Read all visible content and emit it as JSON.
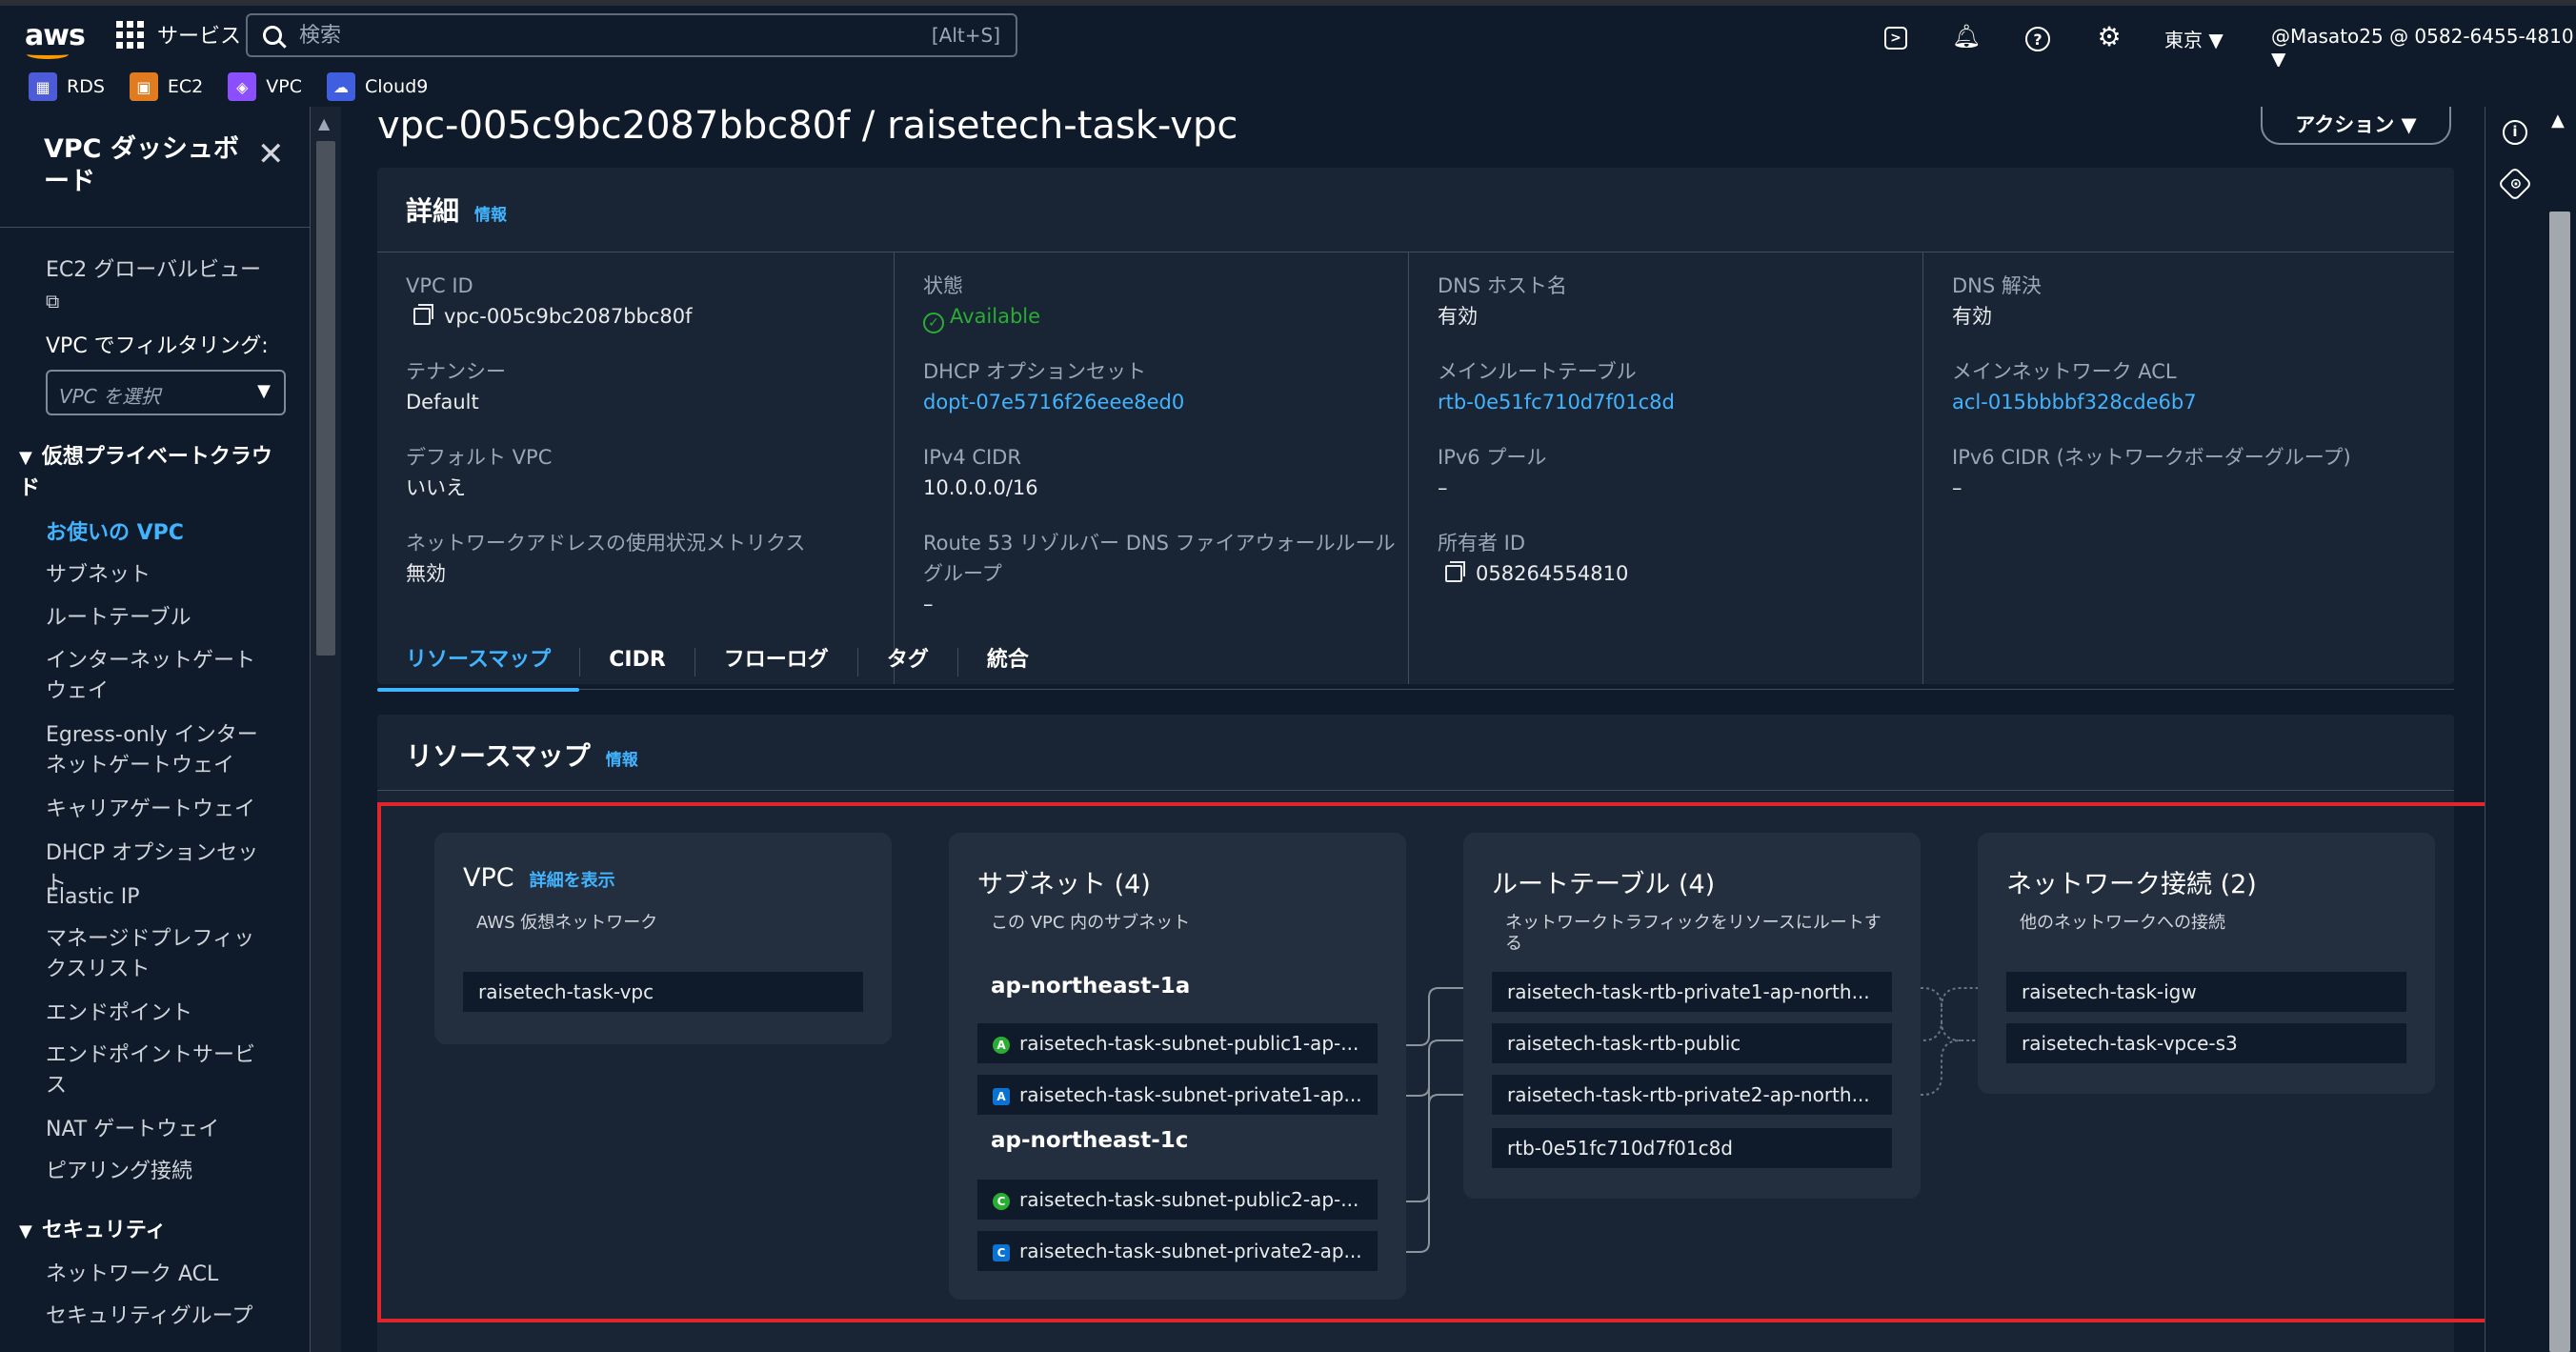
{
  "topnav": {
    "logo": "aws",
    "services_label": "サービス",
    "search_placeholder": "検索",
    "search_shortcut": "[Alt+S]",
    "region": "東京 ▼",
    "account": "@Masato25 @ 0582-6455-4810 ▼",
    "icons": [
      "cloudshell-icon",
      "bell-icon",
      "help-icon",
      "gear-icon"
    ]
  },
  "favorites": [
    {
      "label": "RDS",
      "color": "#4d5bd9"
    },
    {
      "label": "EC2",
      "color": "#e07b1f"
    },
    {
      "label": "VPC",
      "color": "#8c4fff"
    },
    {
      "label": "Cloud9",
      "color": "#3f5ee0"
    }
  ],
  "sidebar": {
    "title": "VPC ダッシュボード",
    "ec2_global_view": "EC2 グローバルビュー",
    "filter_label": "VPC でフィルタリング:",
    "filter_placeholder": "VPC を選択",
    "section_vpc": "仮想プライベートクラウド",
    "vpc_items": [
      "お使いの VPC",
      "サブネット",
      "ルートテーブル",
      "インターネットゲートウェイ",
      "Egress-only インターネットゲートウェイ",
      "キャリアゲートウェイ",
      "DHCP オプションセット",
      "Elastic IP",
      "マネージドプレフィックスリスト",
      "エンドポイント",
      "エンドポイントサービス",
      "NAT ゲートウェイ",
      "ピアリング接続"
    ],
    "section_security": "セキュリティ",
    "security_items": [
      "ネットワーク ACL",
      "セキュリティグループ"
    ]
  },
  "main": {
    "title": "vpc-005c9bc2087bbc80f / raisetech-task-vpc",
    "actions_label": "アクション ▼",
    "details_header": "詳細",
    "info": "情報",
    "fields": {
      "vpc_id_label": "VPC ID",
      "vpc_id": "vpc-005c9bc2087bbc80f",
      "tenancy_label": "テナンシー",
      "tenancy": "Default",
      "default_vpc_label": "デフォルト VPC",
      "default_vpc": "いいえ",
      "metrics_label": "ネットワークアドレスの使用状況メトリクス",
      "metrics": "無効",
      "state_label": "状態",
      "state": "Available",
      "dhcp_label": "DHCP オプションセット",
      "dhcp": "dopt-07e5716f26eee8ed0",
      "ipv4_label": "IPv4 CIDR",
      "ipv4": "10.0.0.0/16",
      "route53_label": "Route 53 リゾルバー DNS ファイアウォールルールグループ",
      "route53": "–",
      "dns_host_label": "DNS ホスト名",
      "dns_host": "有効",
      "main_rt_label": "メインルートテーブル",
      "main_rt": "rtb-0e51fc710d7f01c8d",
      "ipv6_pool_label": "IPv6 プール",
      "ipv6_pool": "–",
      "owner_label": "所有者 ID",
      "owner": "058264554810",
      "dns_res_label": "DNS 解決",
      "dns_res": "有効",
      "main_acl_label": "メインネットワーク ACL",
      "main_acl": "acl-015bbbbf328cde6b7",
      "ipv6_cidr_label": "IPv6 CIDR (ネットワークボーダーグループ)",
      "ipv6_cidr": "–"
    },
    "tabs": [
      "リソースマップ",
      "CIDR",
      "フローログ",
      "タグ",
      "統合"
    ],
    "resource_map": {
      "header": "リソースマップ",
      "vpc_card": {
        "title": "VPC",
        "link": "詳細を表示",
        "subtitle": "AWS 仮想ネットワーク",
        "item": "raisetech-task-vpc"
      },
      "subnet_card": {
        "title": "サブネット (4)",
        "subtitle": "この VPC 内のサブネット",
        "az1": "ap-northeast-1a",
        "az2": "ap-northeast-1c",
        "items": [
          {
            "badge": "A",
            "type": "pub",
            "label": "raisetech-task-subnet-public1-ap-..."
          },
          {
            "badge": "A",
            "type": "priv",
            "label": "raisetech-task-subnet-private1-ap..."
          },
          {
            "badge": "C",
            "type": "pub",
            "label": "raisetech-task-subnet-public2-ap-..."
          },
          {
            "badge": "C",
            "type": "priv",
            "label": "raisetech-task-subnet-private2-ap..."
          }
        ]
      },
      "rt_card": {
        "title": "ルートテーブル (4)",
        "subtitle": "ネットワークトラフィックをリソースにルートする",
        "items": [
          "raisetech-task-rtb-private1-ap-north...",
          "raisetech-task-rtb-public",
          "raisetech-task-rtb-private2-ap-north...",
          "rtb-0e51fc710d7f01c8d"
        ]
      },
      "net_card": {
        "title": "ネットワーク接続 (2)",
        "subtitle": "他のネットワークへの接続",
        "items": [
          "raisetech-task-igw",
          "raisetech-task-vpce-s3"
        ]
      }
    }
  },
  "colors": {
    "link": "#42b4ff",
    "highlight": "#e0262b",
    "ok": "#29ad32"
  }
}
